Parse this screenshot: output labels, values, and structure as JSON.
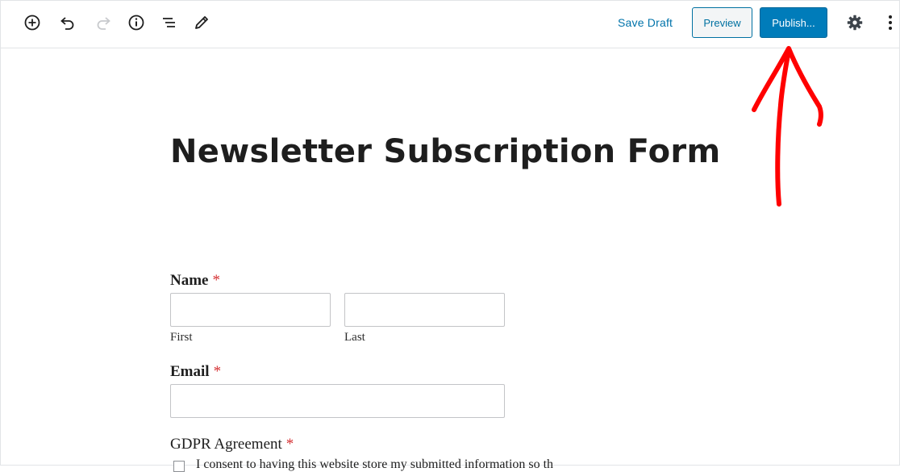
{
  "toolbar": {
    "save_draft_label": "Save Draft",
    "preview_label": "Preview",
    "publish_label": "Publish...",
    "icons": [
      "add-block-icon",
      "undo-icon",
      "redo-icon",
      "info-icon",
      "block-navigation-icon",
      "edit-icon",
      "gear-icon",
      "more-options-icon"
    ]
  },
  "page": {
    "title": "Newsletter Subscription Form"
  },
  "form": {
    "name_label": "Name",
    "required_mark": "*",
    "first_sublabel": "First",
    "last_sublabel": "Last",
    "email_label": "Email",
    "gdpr_label": "GDPR Agreement",
    "gdpr_text": "I consent to having this website store my submitted information so th"
  },
  "colors": {
    "accent": "#007cba",
    "link": "#0073aa",
    "required": "#d63638",
    "annotation_arrow": "#ff0000"
  }
}
